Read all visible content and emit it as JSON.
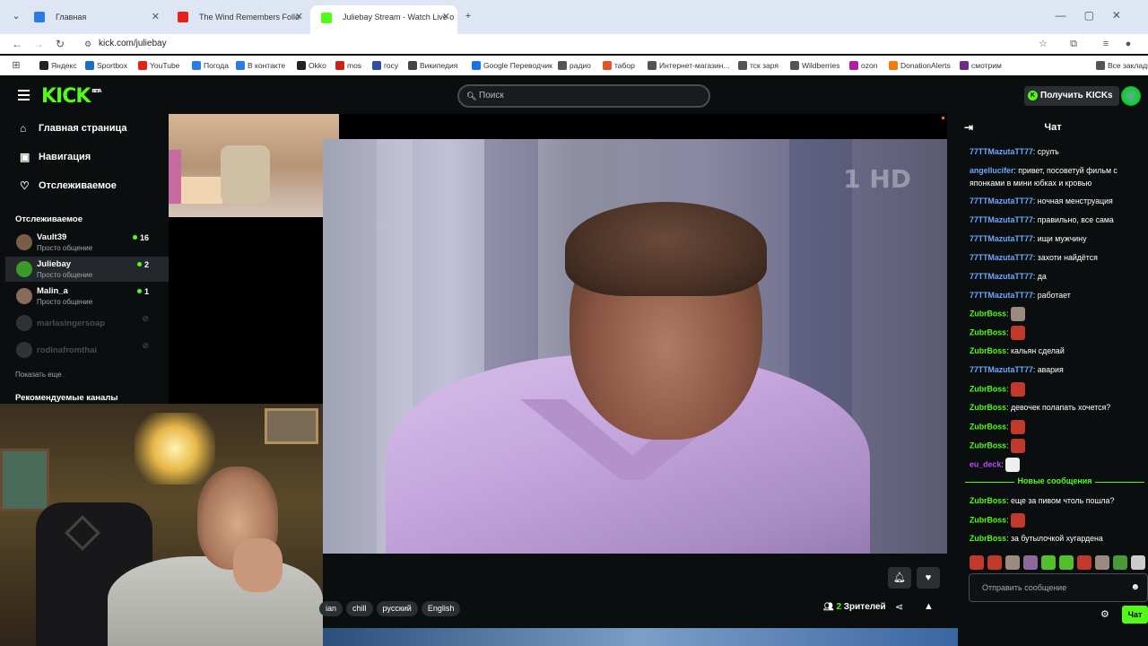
{
  "browser": {
    "tabs": [
      {
        "title": "Главная",
        "active": false,
        "favicon_color": "#2c7be5"
      },
      {
        "title": "The Wind Remembers Follo",
        "active": false,
        "favicon_color": "#e62117"
      },
      {
        "title": "Juliebay Stream - Watch Live o",
        "active": true,
        "favicon_color": "#53fc18"
      }
    ],
    "new_tab": "+",
    "url": "kick.com/juliebay",
    "bookmarks": [
      {
        "label": "Яндекс",
        "color": "#222"
      },
      {
        "label": "Sportbox",
        "color": "#1a6fc1"
      },
      {
        "label": "YouTube",
        "color": "#e62117"
      },
      {
        "label": "Погода",
        "color": "#2c7be5"
      },
      {
        "label": "В контакте",
        "color": "#2c7be5"
      },
      {
        "label": "Okko",
        "color": "#222"
      },
      {
        "label": "mos",
        "color": "#c21"
      },
      {
        "label": "госу",
        "color": "#2c4fa3"
      },
      {
        "label": "Википедия",
        "color": "#444"
      },
      {
        "label": "Google Переводчик",
        "color": "#1a73e8"
      },
      {
        "label": "радио",
        "color": "#555"
      },
      {
        "label": "табор",
        "color": "#e0562a"
      },
      {
        "label": "Интернет-магазин...",
        "color": "#555"
      },
      {
        "label": "тск заря",
        "color": "#555"
      },
      {
        "label": "Wildberries",
        "color": "#555"
      },
      {
        "label": "ozon",
        "color": "#b01ea7"
      },
      {
        "label": "DonationAlerts",
        "color": "#f57d07"
      },
      {
        "label": "смотрим",
        "color": "#6b2a8c"
      },
      {
        "label": "Все закладки",
        "color": "#555"
      }
    ]
  },
  "header": {
    "logo": "KICK",
    "logo_sup": "BETA",
    "search_placeholder": "Поиск",
    "get_kicks": "Получить KICKs"
  },
  "sidebar": {
    "nav": [
      {
        "label": "Главная страница",
        "icon": "home-icon",
        "glyph": "⌂"
      },
      {
        "label": "Навигация",
        "icon": "compass-icon",
        "glyph": "▣"
      },
      {
        "label": "Отслеживаемое",
        "icon": "heart-icon",
        "glyph": "♡"
      }
    ],
    "following_title": "Отслеживаемое",
    "channels": [
      {
        "name": "Vault39",
        "category": "Просто общение",
        "viewers": "16",
        "live": true,
        "selected": false,
        "avatar_color": "#7a5c4a"
      },
      {
        "name": "Juliebay",
        "category": "Просто общение",
        "viewers": "2",
        "live": true,
        "selected": true,
        "avatar_color": "#3a9a2a"
      },
      {
        "name": "Malin_a",
        "category": "Просто общение",
        "viewers": "1",
        "live": true,
        "selected": false,
        "avatar_color": "#8a6a5a"
      },
      {
        "name": "marlasingersoap",
        "category": "",
        "viewers": "",
        "live": false,
        "selected": false,
        "avatar_color": "#888"
      },
      {
        "name": "rodinafromthai",
        "category": "",
        "viewers": "",
        "live": false,
        "selected": false,
        "avatar_color": "#888"
      }
    ],
    "show_more": "Показать еще",
    "recommended_title": "Рекомендуемые каналы"
  },
  "video": {
    "tv_logo": "1 HD"
  },
  "stream_meta": {
    "tags": [
      "ian",
      "chill",
      "русский",
      "English"
    ],
    "viewers_count": "2",
    "viewers_label": "Зрителей"
  },
  "chat": {
    "title": "Чат",
    "messages": [
      {
        "user": "77TTMazutaTT77",
        "color": "#6fa8ff",
        "text": "срулъ"
      },
      {
        "user": "angellucifer",
        "color": "#6fa8ff",
        "text": "привет, посоветуй фильм с японками в мини юбках и кровью"
      },
      {
        "user": "77TTMazutaTT77",
        "color": "#6fa8ff",
        "text": "ночная менструация"
      },
      {
        "user": "77TTMazutaTT77",
        "color": "#6fa8ff",
        "text": "правильно, все сама"
      },
      {
        "user": "77TTMazutaTT77",
        "color": "#6fa8ff",
        "text": "ищи мужчину"
      },
      {
        "user": "77TTMazutaTT77",
        "color": "#6fa8ff",
        "text": "захоти найдётся"
      },
      {
        "user": "77TTMazutaTT77",
        "color": "#6fa8ff",
        "text": "да"
      },
      {
        "user": "77TTMazutaTT77",
        "color": "#6fa8ff",
        "text": "работает"
      },
      {
        "user": "ZubrBoss",
        "color": "#53fc18",
        "text": "",
        "emote": "#9a8a80"
      },
      {
        "user": "ZubrBoss",
        "color": "#53fc18",
        "text": "",
        "emote": "#c0392b"
      },
      {
        "user": "ZubrBoss",
        "color": "#53fc18",
        "text": "кальян сделай"
      },
      {
        "user": "77TTMazutaTT77",
        "color": "#6fa8ff",
        "text": "авария"
      },
      {
        "user": "ZubrBoss",
        "color": "#53fc18",
        "text": "",
        "emote": "#c0392b"
      },
      {
        "user": "ZubrBoss",
        "color": "#53fc18",
        "text": "девочек полапать хочется?"
      },
      {
        "user": "ZubrBoss",
        "color": "#53fc18",
        "text": "",
        "emote": "#c0392b"
      },
      {
        "user": "ZubrBoss",
        "color": "#53fc18",
        "text": "",
        "emote": "#c0392b"
      },
      {
        "user": "eu_deck",
        "color": "#b84cff",
        "text": "",
        "emote": "#eeeeee"
      }
    ],
    "new_messages_label": "Новые сообщения",
    "new_messages": [
      {
        "user": "ZubrBoss",
        "color": "#53fc18",
        "text": "еще за пивом чтоль пошла?"
      },
      {
        "user": "ZubrBoss",
        "color": "#53fc18",
        "text": "",
        "emote": "#c0392b"
      },
      {
        "user": "ZubrBoss",
        "color": "#53fc18",
        "text": "за бутылочкой хугардена"
      }
    ],
    "emote_row": [
      "#c0392b",
      "#c0392b",
      "#9a8a80",
      "#8a6a9a",
      "#53c02b",
      "#53c02b",
      "#c0392b",
      "#9a8a80",
      "#4a9a3a",
      "#ccc",
      "#53c02b",
      "#c66"
    ],
    "input_placeholder": "Отправить сообщение",
    "send_label": "Чат"
  }
}
